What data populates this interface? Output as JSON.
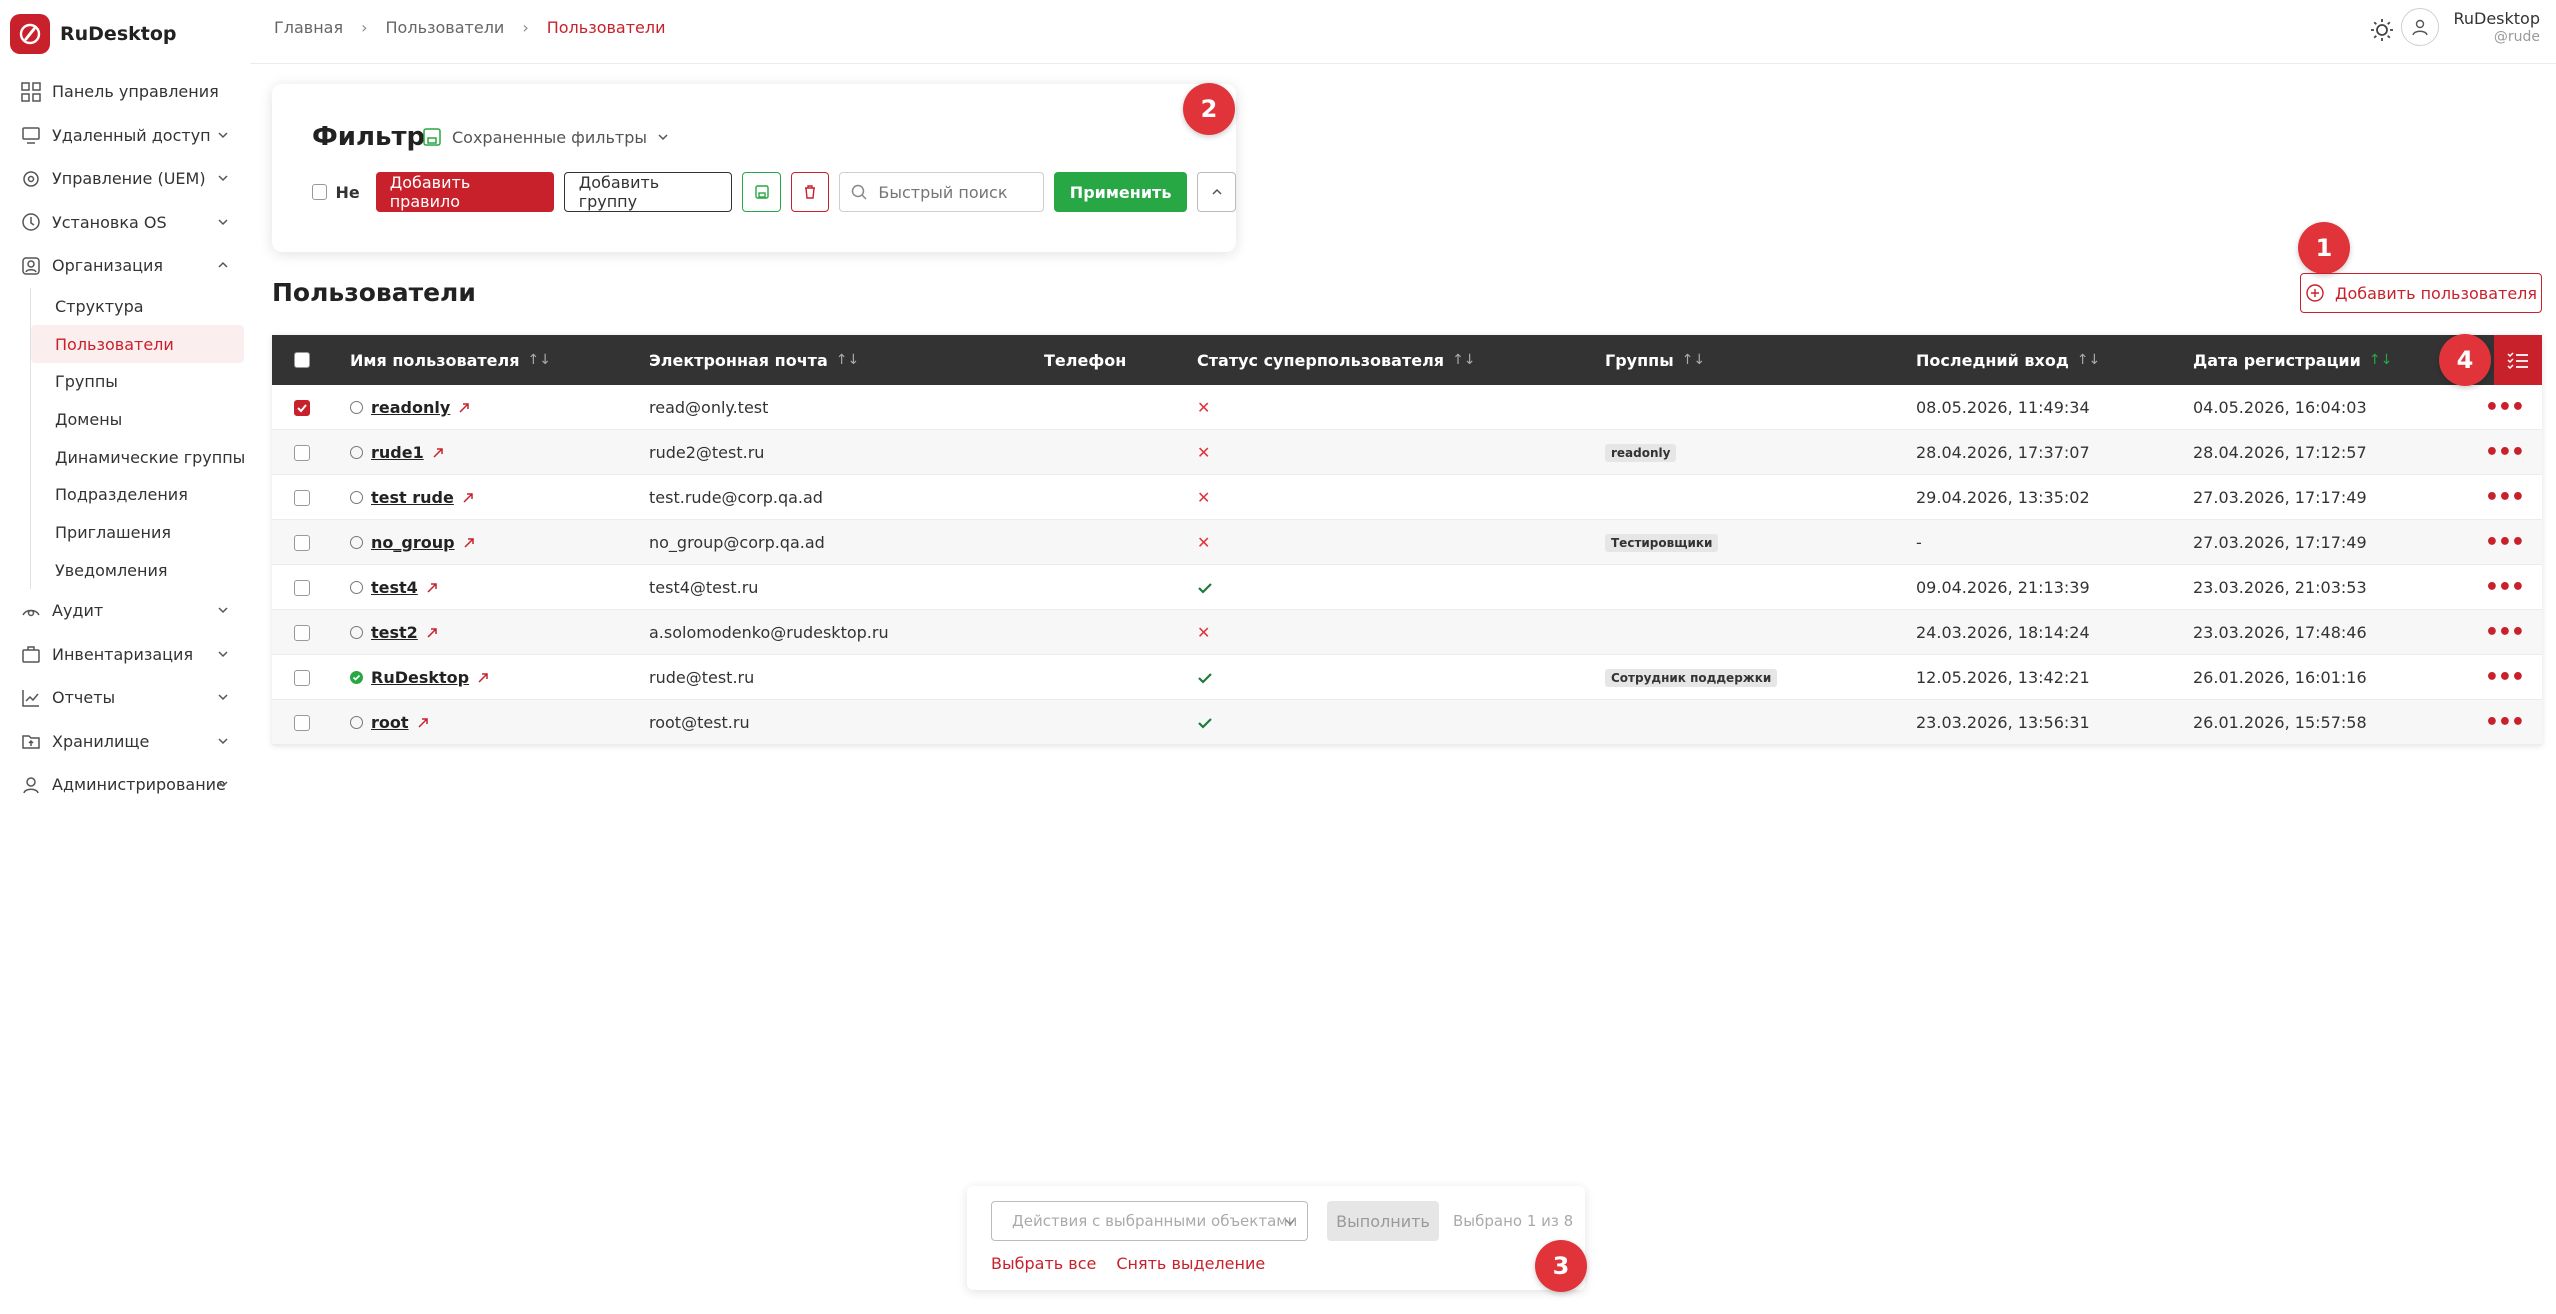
{
  "app": {
    "name": "RuDesktop"
  },
  "breadcrumbs": [
    "Главная",
    "Пользователи",
    "Пользователи"
  ],
  "user": {
    "name": "RuDesktop",
    "handle": "@rude"
  },
  "sidebar": {
    "items": [
      {
        "label": "Панель управления",
        "icon": "dashboard-icon"
      },
      {
        "label": "Удаленный доступ",
        "icon": "remote-icon",
        "expandable": true
      },
      {
        "label": "Управление (UEM)",
        "icon": "settings-icon",
        "expandable": true
      },
      {
        "label": "Установка OS",
        "icon": "install-icon",
        "expandable": true
      },
      {
        "label": "Организация",
        "icon": "organization-icon",
        "expandable": true,
        "expanded": true
      }
    ],
    "org_sub": [
      "Структура",
      "Пользователи",
      "Группы",
      "Домены",
      "Динамические группы",
      "Подразделения",
      "Приглашения",
      "Уведомления"
    ],
    "items_after": [
      {
        "label": "Аудит",
        "icon": "audit-icon"
      },
      {
        "label": "Инвентаризация",
        "icon": "inventory-icon"
      },
      {
        "label": "Отчеты",
        "icon": "reports-icon"
      },
      {
        "label": "Хранилище",
        "icon": "storage-icon"
      },
      {
        "label": "Администрирование",
        "icon": "admin-icon"
      }
    ]
  },
  "filter": {
    "title": "Фильтр",
    "saved_filters": "Сохраненные фильтры",
    "not_label": "Не",
    "add_rule": "Добавить правило",
    "add_group": "Добавить группу",
    "search_placeholder": "Быстрый поиск",
    "apply": "Применить"
  },
  "page_title": "Пользователи",
  "add_user": "Добавить пользователя",
  "table": {
    "columns": [
      "Имя пользователя",
      "Электронная почта",
      "Телефон",
      "Статус суперпользователя",
      "Группы",
      "Последний вход",
      "Дата регистрации"
    ],
    "rows": [
      {
        "name": "readonly",
        "email": "read@only.test",
        "phone": "",
        "superuser": false,
        "group": "",
        "last_login": "08.05.2026, 11:49:34",
        "registered": "04.05.2026, 16:04:03",
        "selected": true,
        "online": false
      },
      {
        "name": "rude1",
        "email": "rude2@test.ru",
        "phone": "",
        "superuser": false,
        "group": "readonly",
        "last_login": "28.04.2026, 17:37:07",
        "registered": "28.04.2026, 17:12:57",
        "selected": false,
        "online": false
      },
      {
        "name": "test rude",
        "email": "test.rude@corp.qa.ad",
        "phone": "",
        "superuser": false,
        "group": "",
        "last_login": "29.04.2026, 13:35:02",
        "registered": "27.03.2026, 17:17:49",
        "selected": false,
        "online": false
      },
      {
        "name": "no_group",
        "email": "no_group@corp.qa.ad",
        "phone": "",
        "superuser": false,
        "group": "Тестировщики",
        "last_login": "-",
        "registered": "27.03.2026, 17:17:49",
        "selected": false,
        "online": false
      },
      {
        "name": "test4",
        "email": "test4@test.ru",
        "phone": "",
        "superuser": true,
        "group": "",
        "last_login": "09.04.2026, 21:13:39",
        "registered": "23.03.2026, 21:03:53",
        "selected": false,
        "online": false
      },
      {
        "name": "test2",
        "email": "a.solomodenko@rudesktop.ru",
        "phone": "",
        "superuser": false,
        "group": "",
        "last_login": "24.03.2026, 18:14:24",
        "registered": "23.03.2026, 17:48:46",
        "selected": false,
        "online": false
      },
      {
        "name": "RuDesktop",
        "email": "rude@test.ru",
        "phone": "",
        "superuser": true,
        "group": "Сотрудник поддержки",
        "last_login": "12.05.2026, 13:42:21",
        "registered": "26.01.2026, 16:01:16",
        "selected": false,
        "online": true
      },
      {
        "name": "root",
        "email": "root@test.ru",
        "phone": "",
        "superuser": true,
        "group": "",
        "last_login": "23.03.2026, 13:56:31",
        "registered": "26.01.2026, 15:57:58",
        "selected": false,
        "online": false
      }
    ]
  },
  "bulk": {
    "actions_placeholder": "Действия с выбранными объектами",
    "execute": "Выполнить",
    "selected_count": "Выбрано 1 из 8",
    "select_all": "Выбрать все",
    "deselect": "Снять выделение"
  },
  "markers": [
    "1",
    "2",
    "3",
    "4"
  ],
  "colors": {
    "accent": "#c8212b",
    "success": "#28a745",
    "header": "#333333"
  }
}
